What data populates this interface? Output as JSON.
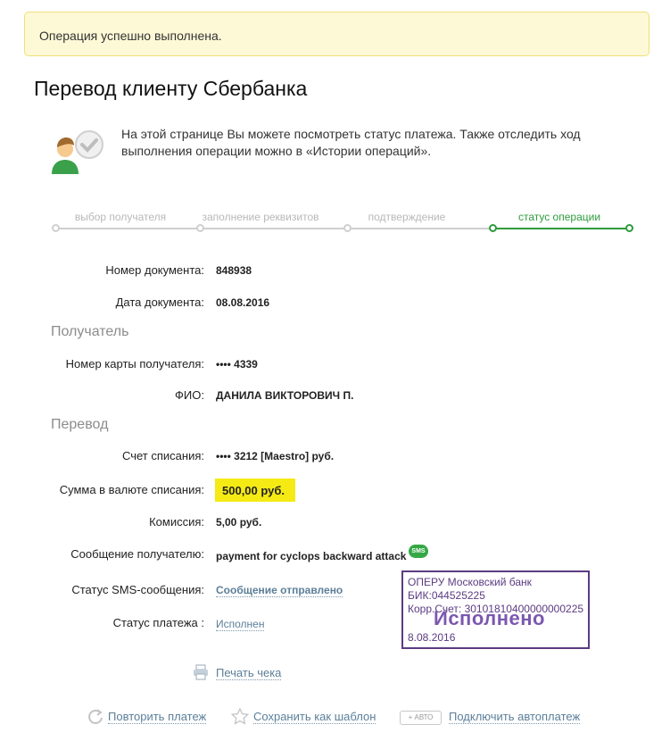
{
  "notice": {
    "text": "Операция успешно выполнена."
  },
  "page": {
    "title": "Перевод клиенту Сбербанка",
    "intro": "На этой странице Вы можете посмотреть статус платежа. Также отследить ход выполнения операции можно в «Истории операций»."
  },
  "steps": [
    {
      "label": "выбор получателя",
      "state": "done"
    },
    {
      "label": "заполнение реквизитов",
      "state": "done"
    },
    {
      "label": "подтверждение",
      "state": "done"
    },
    {
      "label": "статус операции",
      "state": "active"
    }
  ],
  "document": {
    "number_label": "Номер документа:",
    "number_value": "848938",
    "date_label": "Дата документа:",
    "date_value": "08.08.2016"
  },
  "recipient": {
    "section_title": "Получатель",
    "card_label": "Номер карты получателя:",
    "card_value": "•••• 4339",
    "name_label": "ФИО:",
    "name_value": "ДАНИЛА ВИКТОРОВИЧ П."
  },
  "transfer": {
    "section_title": "Перевод",
    "account_label": "Счет списания:",
    "account_value": "•••• 3212  [Maestro]  руб.",
    "amount_label": "Сумма в валюте списания:",
    "amount_value": "500,00  руб.",
    "fee_label": "Комиссия:",
    "fee_value": "5,00 руб.",
    "message_label": "Сообщение получателю:",
    "message_value": "payment for cyclops backward attack",
    "sms_badge": "SMS",
    "sms_status_label": "Статус SMS-сообщения:",
    "sms_status_value": "Сообщение отправлено",
    "payment_status_label": "Статус платежа :",
    "payment_status_value": "Исполнен"
  },
  "stamp": {
    "line1": "ОПЕРУ Московский банк",
    "line2": "БИК:044525225",
    "line3": "Корр.Счет: 30101810400000000225",
    "big": "Исполнено",
    "date": "8.08.2016"
  },
  "actions": {
    "print": "Печать чека",
    "repeat": "Повторить платеж",
    "save_template": "Сохранить как шаблон",
    "auto_badge": "+ АВТО",
    "autopay": "Подключить автоплатеж"
  },
  "colors": {
    "accent_green": "#2e9b3c",
    "link": "#5c7f99",
    "highlight": "#f5ea14",
    "stamp": "#5b3b82"
  }
}
